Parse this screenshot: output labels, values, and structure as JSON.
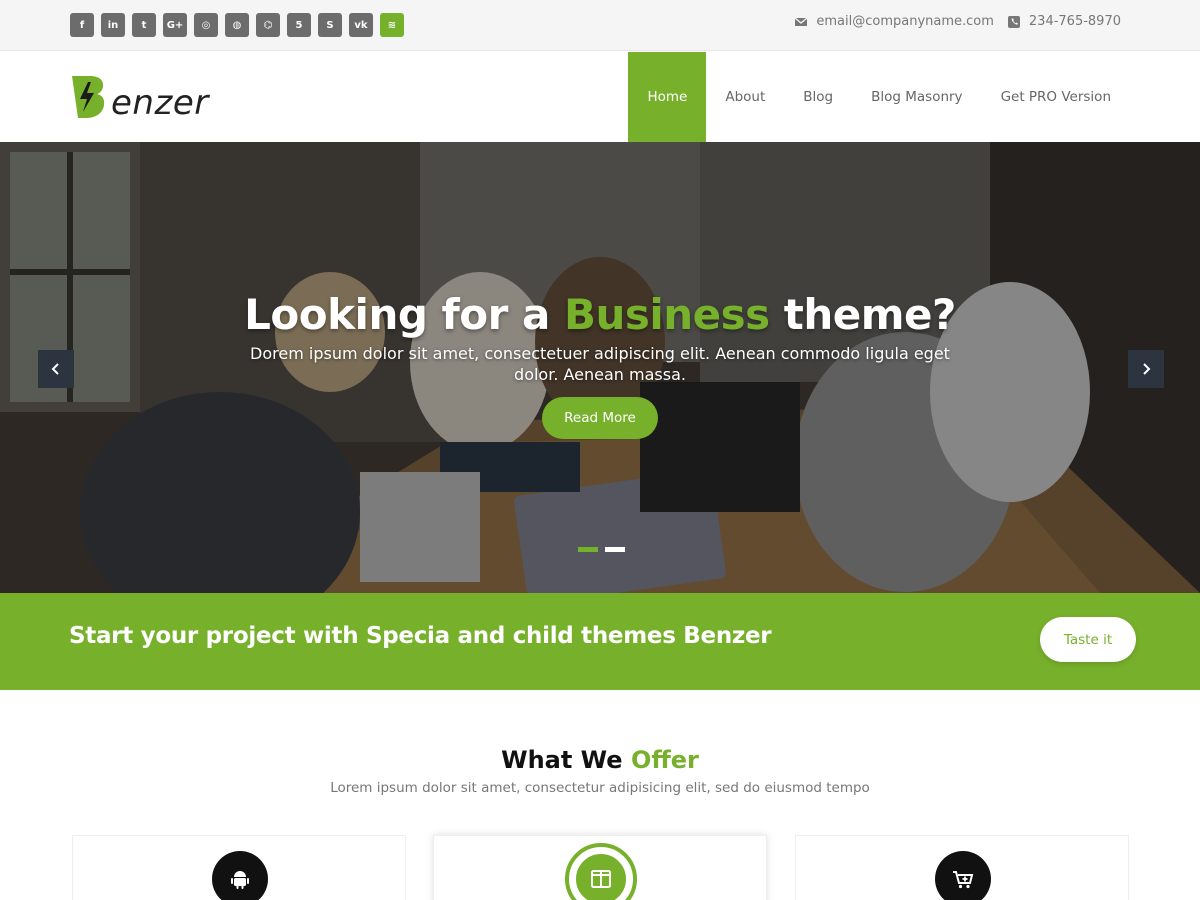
{
  "topbar": {
    "social_icons": [
      {
        "name": "facebook-icon",
        "glyph": "f"
      },
      {
        "name": "linkedin-icon",
        "glyph": "in"
      },
      {
        "name": "twitter-icon",
        "glyph": "t"
      },
      {
        "name": "google-plus-icon",
        "glyph": "G+"
      },
      {
        "name": "instagram-icon",
        "glyph": "◎"
      },
      {
        "name": "dribbble-icon",
        "glyph": "◍"
      },
      {
        "name": "github-icon",
        "glyph": "⌬"
      },
      {
        "name": "html5-icon",
        "glyph": "5"
      },
      {
        "name": "skype-icon",
        "glyph": "S"
      },
      {
        "name": "vk-icon",
        "glyph": "vk"
      },
      {
        "name": "spotify-icon",
        "glyph": "≋"
      }
    ],
    "email": "email@companyname.com",
    "phone": "234-765-8970"
  },
  "header": {
    "logo_text": "enzer",
    "nav": [
      {
        "label": "Home",
        "active": true
      },
      {
        "label": "About",
        "active": false
      },
      {
        "label": "Blog",
        "active": false
      },
      {
        "label": "Blog Masonry",
        "active": false
      },
      {
        "label": "Get PRO Version",
        "active": false
      }
    ]
  },
  "hero": {
    "title_before": "Looking for a ",
    "title_highlight": "Business",
    "title_after": " theme?",
    "description": "Dorem ipsum dolor sit amet, consectetuer adipiscing elit. Aenean commodo ligula eget dolor. Aenean massa.",
    "button_label": "Read More",
    "slides": 2,
    "active_slide": 1
  },
  "cta": {
    "text": "Start your project with Specia and child themes Benzer",
    "button_label": "Taste it"
  },
  "offer": {
    "title_before": "What We ",
    "title_highlight": "Offer",
    "subtitle": "Lorem ipsum dolor sit amet, consectetur adipisicing elit, sed do eiusmod tempo",
    "cards": [
      {
        "icon": "android-icon"
      },
      {
        "icon": "columns-icon"
      },
      {
        "icon": "cart-plus-icon"
      }
    ]
  },
  "colors": {
    "accent": "#77b12c",
    "dark": "#2c3440"
  }
}
